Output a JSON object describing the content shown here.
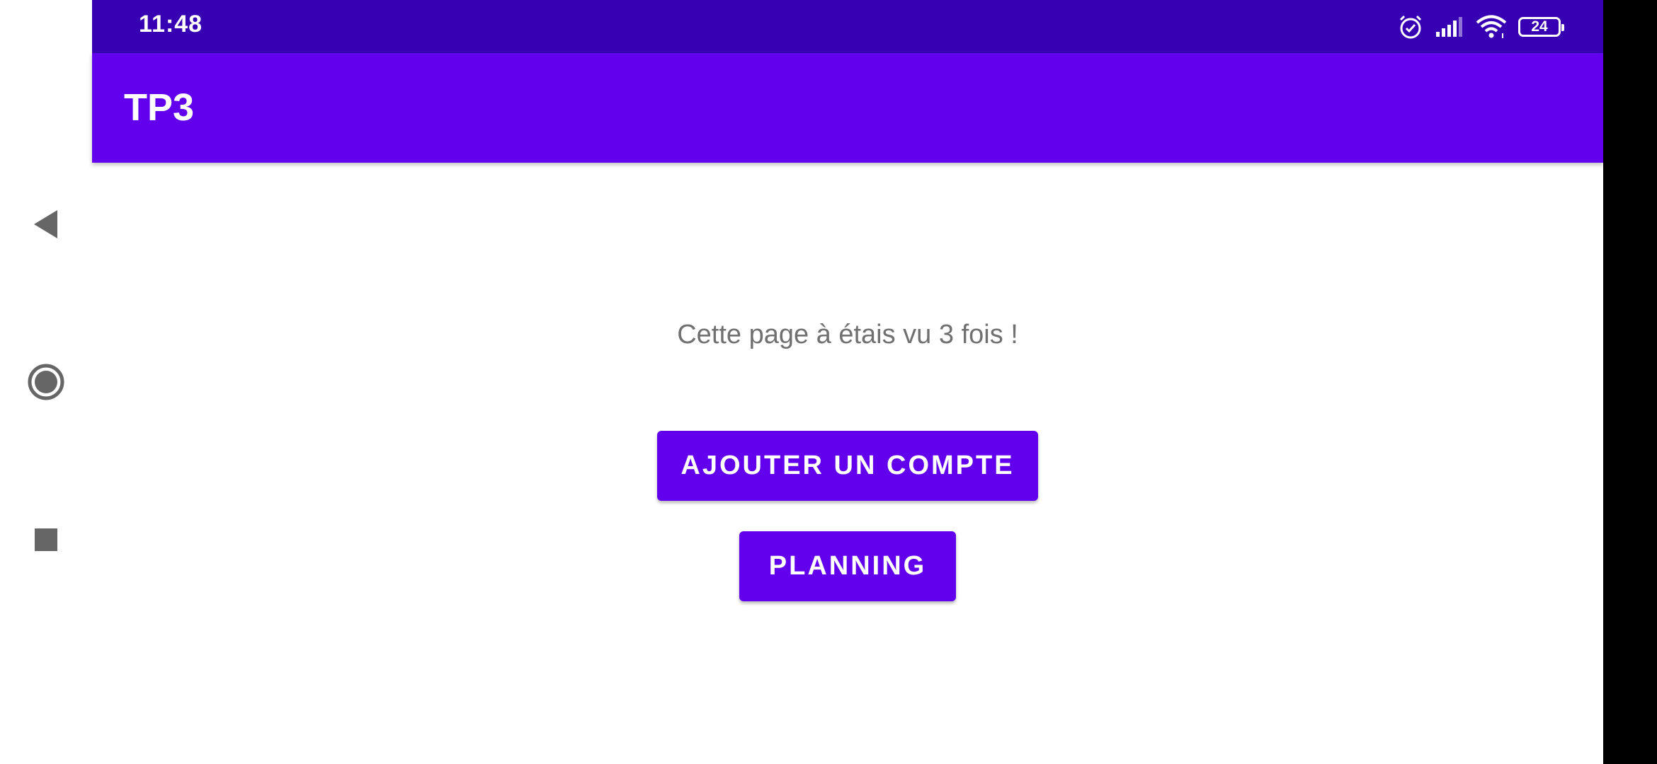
{
  "status_bar": {
    "time": "11:48",
    "icons": [
      "alarm-icon",
      "signal-icon",
      "wifi-icon",
      "battery-icon"
    ],
    "battery_level": "24"
  },
  "app_bar": {
    "title": "TP3"
  },
  "main": {
    "counter_text": "Cette page à étais vu 3 fois !",
    "add_account_label": "AJOUTER UN COMPTE",
    "planning_label": "PLANNING"
  },
  "navigation": {
    "icons": [
      "back-icon",
      "home-icon",
      "recents-icon"
    ]
  },
  "colors": {
    "status_bar": "#3700B3",
    "primary": "#6200EE",
    "counter_text": "#707070",
    "nav_icon": "#666666"
  }
}
